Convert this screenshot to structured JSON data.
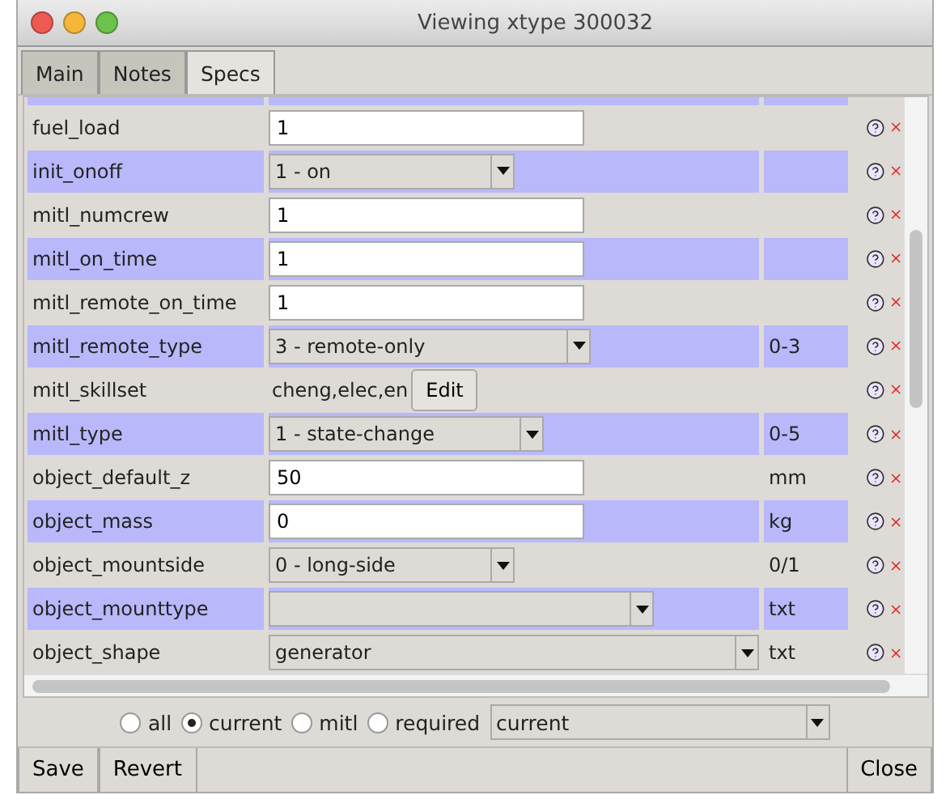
{
  "window": {
    "title": "Viewing xtype 300032"
  },
  "tabs": [
    {
      "label": "Main",
      "selected": false
    },
    {
      "label": "Notes",
      "selected": false
    },
    {
      "label": "Specs",
      "selected": true
    }
  ],
  "rows": [
    {
      "name": "fuel_load",
      "kind": "text",
      "value": "1",
      "highlighted": false
    },
    {
      "name": "init_onoff",
      "kind": "select",
      "value": "1 - on",
      "highlighted": true
    },
    {
      "name": "mitl_numcrew",
      "kind": "text",
      "value": "1",
      "highlighted": false
    },
    {
      "name": "mitl_on_time",
      "kind": "text",
      "value": "1",
      "highlighted": true
    },
    {
      "name": "mitl_remote_on_time",
      "kind": "text",
      "value": "1",
      "highlighted": false
    },
    {
      "name": "mitl_remote_type",
      "kind": "select",
      "value": "3 - remote-only",
      "unit": "0-3",
      "highlighted": true
    },
    {
      "name": "mitl_skillset",
      "kind": "edit",
      "value": "cheng,elec,en",
      "button": "Edit",
      "highlighted": false
    },
    {
      "name": "mitl_type",
      "kind": "select",
      "value": "1 - state-change",
      "unit": "0-5",
      "highlighted": true
    },
    {
      "name": "object_default_z",
      "kind": "text",
      "value": "50",
      "unit": "mm",
      "highlighted": false
    },
    {
      "name": "object_mass",
      "kind": "text",
      "value": "0",
      "unit": "kg",
      "highlighted": true
    },
    {
      "name": "object_mountside",
      "kind": "select",
      "value": "0 - long-side",
      "unit": "0/1",
      "highlighted": false
    },
    {
      "name": "object_mounttype",
      "kind": "select",
      "unit": "txt",
      "highlighted": true
    },
    {
      "name": "object_shape",
      "kind": "select",
      "value": "generator",
      "unit": "txt",
      "highlighted": false
    }
  ],
  "filter": {
    "options": [
      {
        "label": "all",
        "selected": false
      },
      {
        "label": "current",
        "selected": true
      },
      {
        "label": "mitl",
        "selected": false
      },
      {
        "label": "required",
        "selected": false
      }
    ],
    "dropdown": "current"
  },
  "buttons": {
    "left": [
      "Save",
      "Revert"
    ],
    "right": [
      "Close"
    ]
  }
}
